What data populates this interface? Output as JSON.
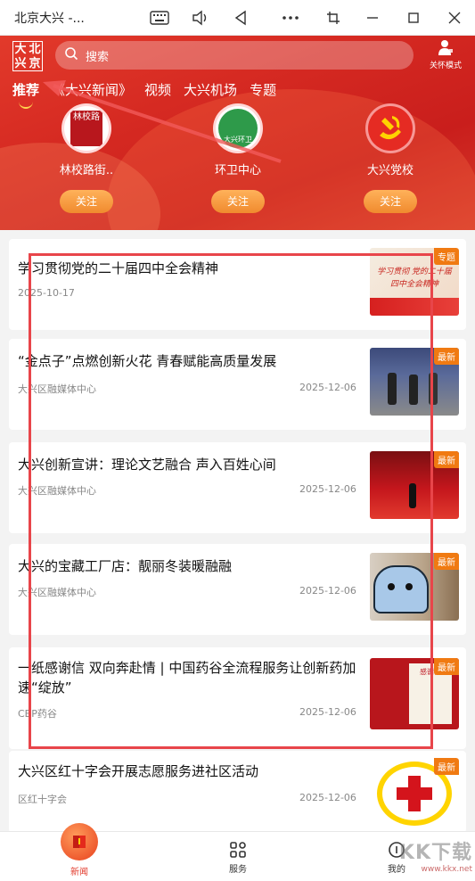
{
  "window": {
    "title": "北京大兴 -..."
  },
  "header": {
    "logo_text": [
      "大",
      "北",
      "兴",
      "京"
    ],
    "search_placeholder": "搜索",
    "care_mode_label": "关怀模式",
    "tabs": [
      {
        "label": "推荐",
        "active": true
      },
      {
        "label": "《大兴新闻》",
        "active": false
      },
      {
        "label": "视频",
        "active": false
      },
      {
        "label": "大兴机场",
        "active": false
      },
      {
        "label": "专题",
        "active": false
      }
    ],
    "channels": [
      {
        "name": "林校路街..",
        "follow_label": "关注",
        "avatar_text": "林校路"
      },
      {
        "name": "环卫中心",
        "follow_label": "关注",
        "avatar_text": "大兴环卫"
      },
      {
        "name": "大兴党校",
        "follow_label": "关注",
        "avatar_text": ""
      }
    ]
  },
  "articles": [
    {
      "title": "学习贯彻党的二十届四中全会精神",
      "source": "",
      "date": "2025-10-17",
      "tag": "专题",
      "thumb_text": "学习贯彻 党的二十届四中全会精神"
    },
    {
      "title": "“金点子”点燃创新火花 青春赋能高质量发展",
      "source": "大兴区融媒体中心",
      "date": "2025-12-06",
      "tag": "最新",
      "thumb_text": ""
    },
    {
      "title": "大兴创新宣讲：理论文艺融合 声入百姓心间",
      "source": "大兴区融媒体中心",
      "date": "2025-12-06",
      "tag": "最新",
      "thumb_text": ""
    },
    {
      "title": "大兴的宝藏工厂店：靓丽冬装暖融融",
      "source": "大兴区融媒体中心",
      "date": "2025-12-06",
      "tag": "最新",
      "thumb_text": ""
    },
    {
      "title": "一纸感谢信 双向奔赴情 | 中国药谷全流程服务让创新药加速“绽放”",
      "source": "CBP药谷",
      "date": "2025-12-06",
      "tag": "最新",
      "thumb_text": "感谢信"
    },
    {
      "title": "大兴区红十字会开展志愿服务进社区活动",
      "source": "区红十字会",
      "date": "2025-12-06",
      "tag": "最新",
      "thumb_text": ""
    }
  ],
  "bottom_nav": [
    {
      "label": "新闻",
      "active": true
    },
    {
      "label": "服务",
      "active": false
    },
    {
      "label": "我的",
      "active": false
    }
  ],
  "watermark": {
    "text": "KK下载",
    "url_text": "www.kkx.net"
  },
  "colors": {
    "header_red": "#d62a22",
    "follow_orange": "#f08a2e",
    "tag_orange": "#f07a12",
    "annotation_red": "#e8454a"
  }
}
